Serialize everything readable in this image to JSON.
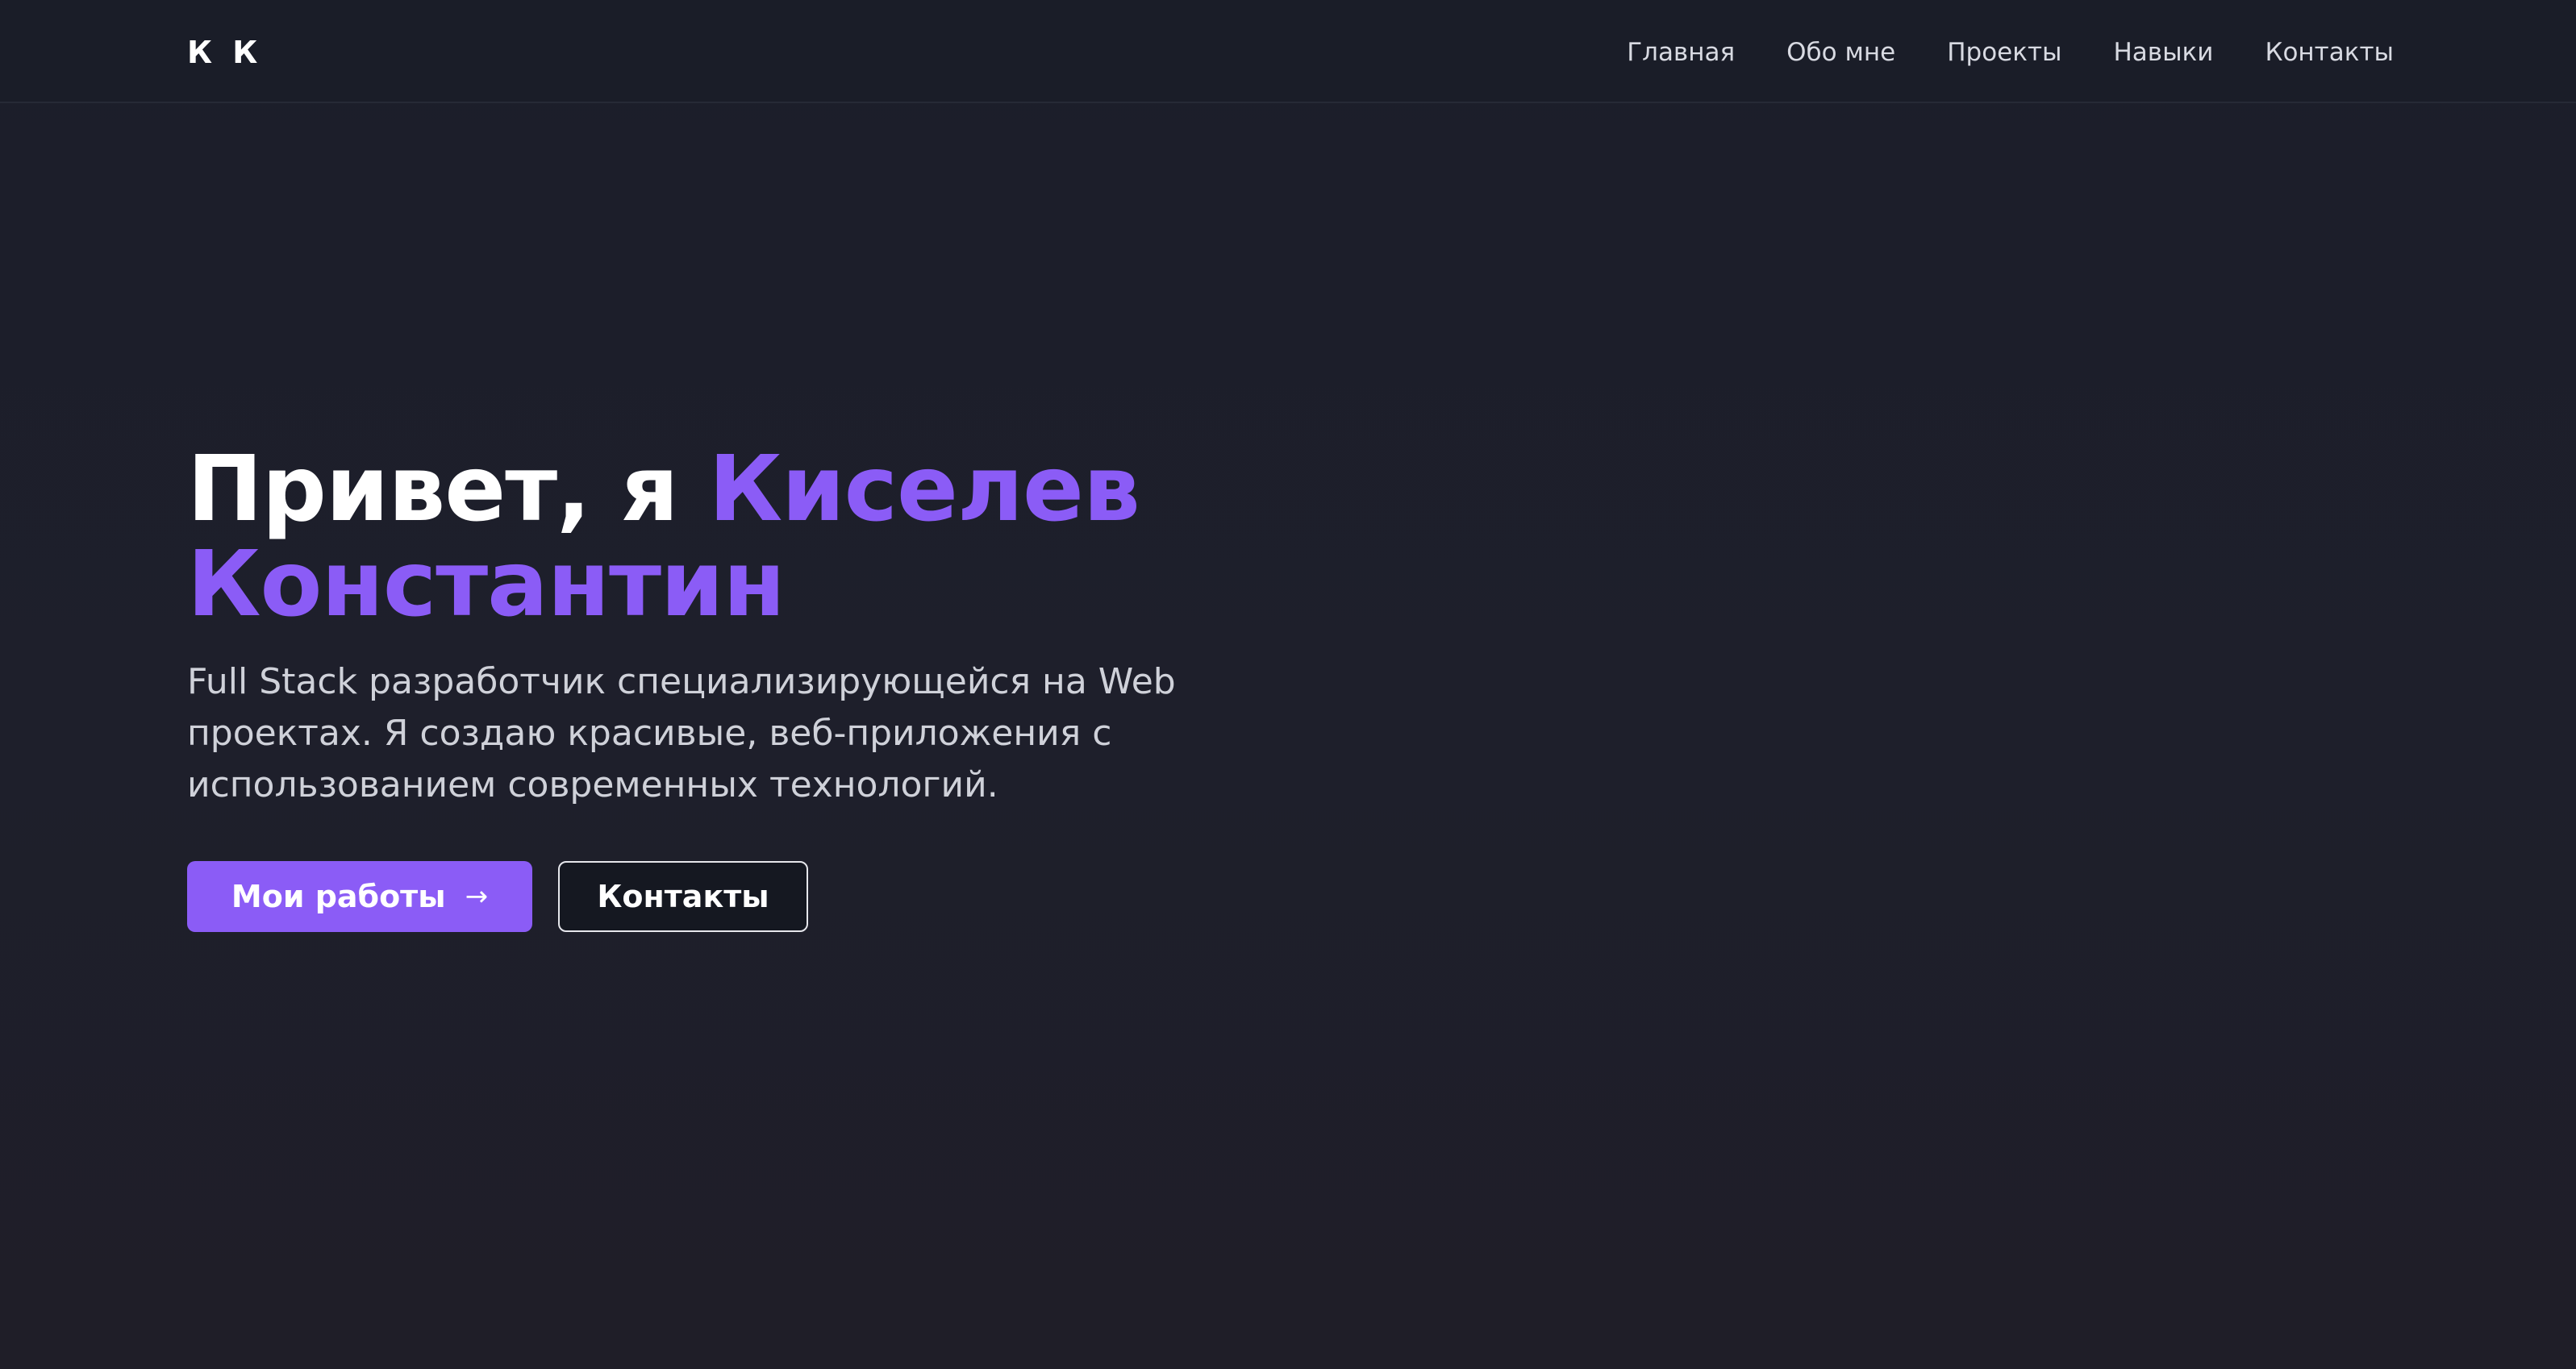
{
  "header": {
    "brand": "К К",
    "nav": [
      {
        "label": "Главная"
      },
      {
        "label": "Обо мне"
      },
      {
        "label": "Проекты"
      },
      {
        "label": "Навыки"
      },
      {
        "label": "Контакты"
      }
    ]
  },
  "hero": {
    "title_prefix": "Привет, я",
    "title_name_line1": "Киселев",
    "title_name_line2": "Константин",
    "description": "Full Stack разработчик специализирующейся на Web проектах. Я создаю красивые, веб-приложения с использованием современных технологий.",
    "primary_button": {
      "label": "Мои работы",
      "icon": "arrow-right-icon"
    },
    "secondary_button": {
      "label": "Контакты"
    }
  },
  "colors": {
    "accent": "#8b5cf6",
    "background": "#1b1e2a",
    "text": "#ffffff"
  }
}
